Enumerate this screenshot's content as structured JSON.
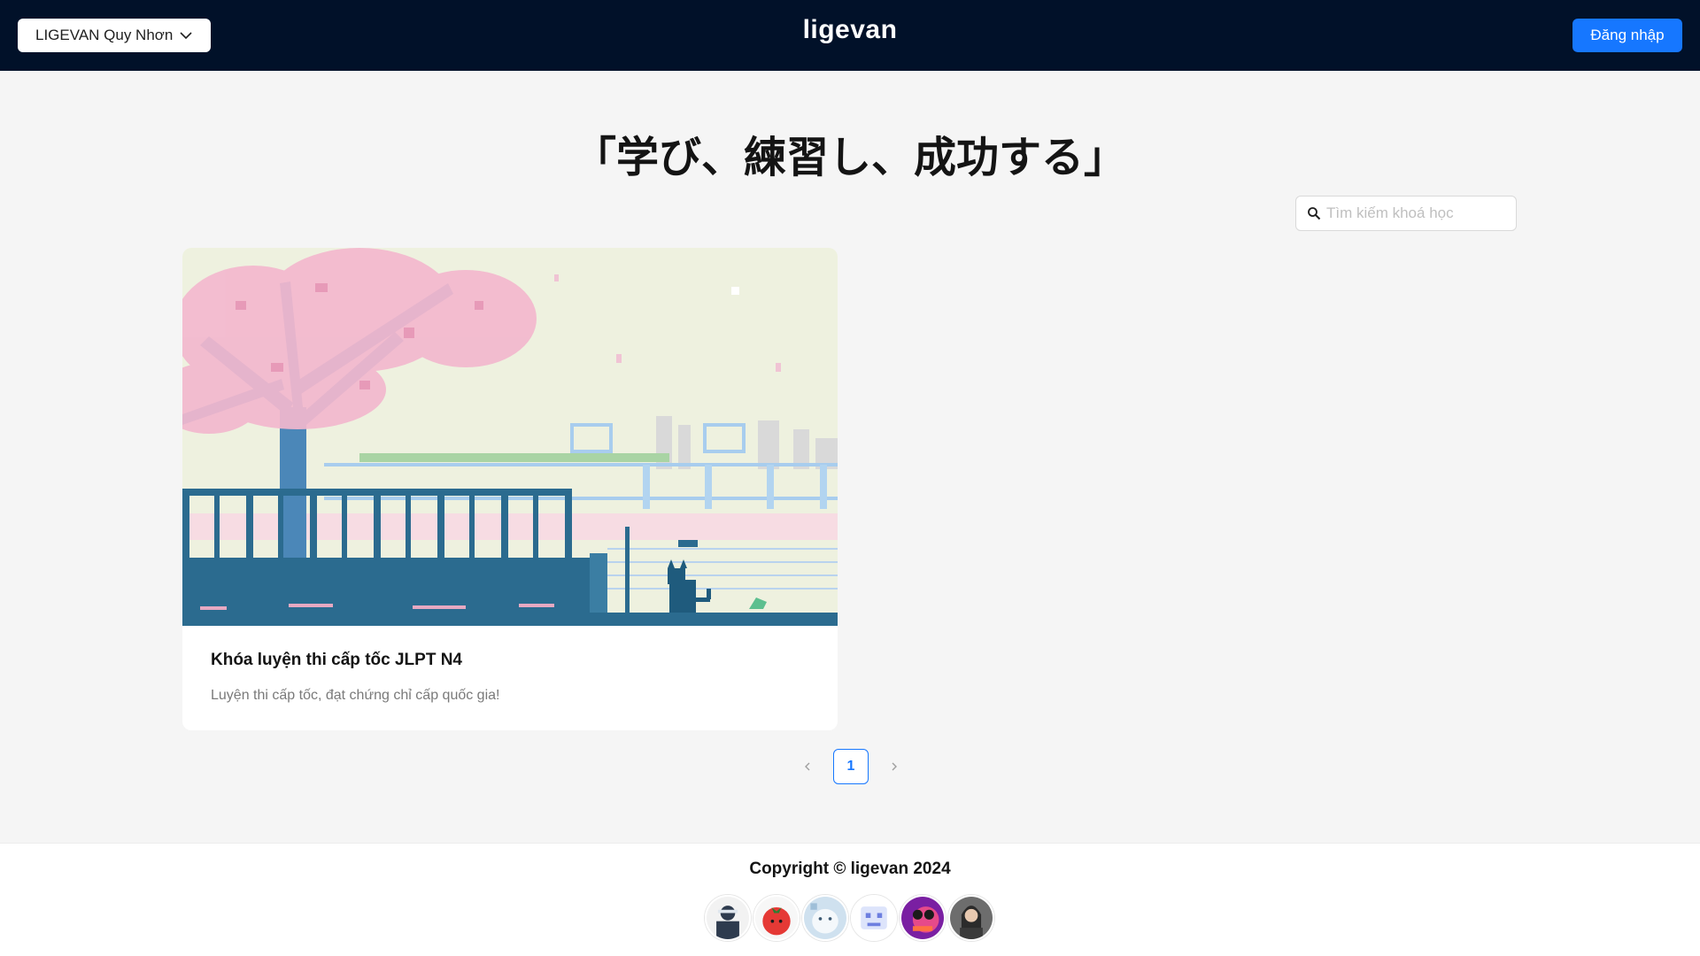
{
  "header": {
    "branch": "LIGEVAN Quy Nhơn",
    "logo": "ligevan",
    "login_label": "Đăng nhập"
  },
  "hero": {
    "title": "「学び、練習し、成功する」"
  },
  "search": {
    "placeholder": "Tìm kiếm khoá học"
  },
  "courses": [
    {
      "title": "Khóa luyện thi cấp tốc JLPT N4",
      "description": "Luyện thi cấp tốc, đạt chứng chỉ cấp quốc gia!"
    }
  ],
  "pagination": {
    "current_page": "1",
    "prev_icon": "chevron-left-icon",
    "next_icon": "chevron-right-icon"
  },
  "footer": {
    "copyright": "Copyright © ligevan 2024",
    "avatar_count": 6
  },
  "colors": {
    "header_bg": "#011129",
    "primary": "#1677ff",
    "page_bg": "#f5f5f5"
  }
}
